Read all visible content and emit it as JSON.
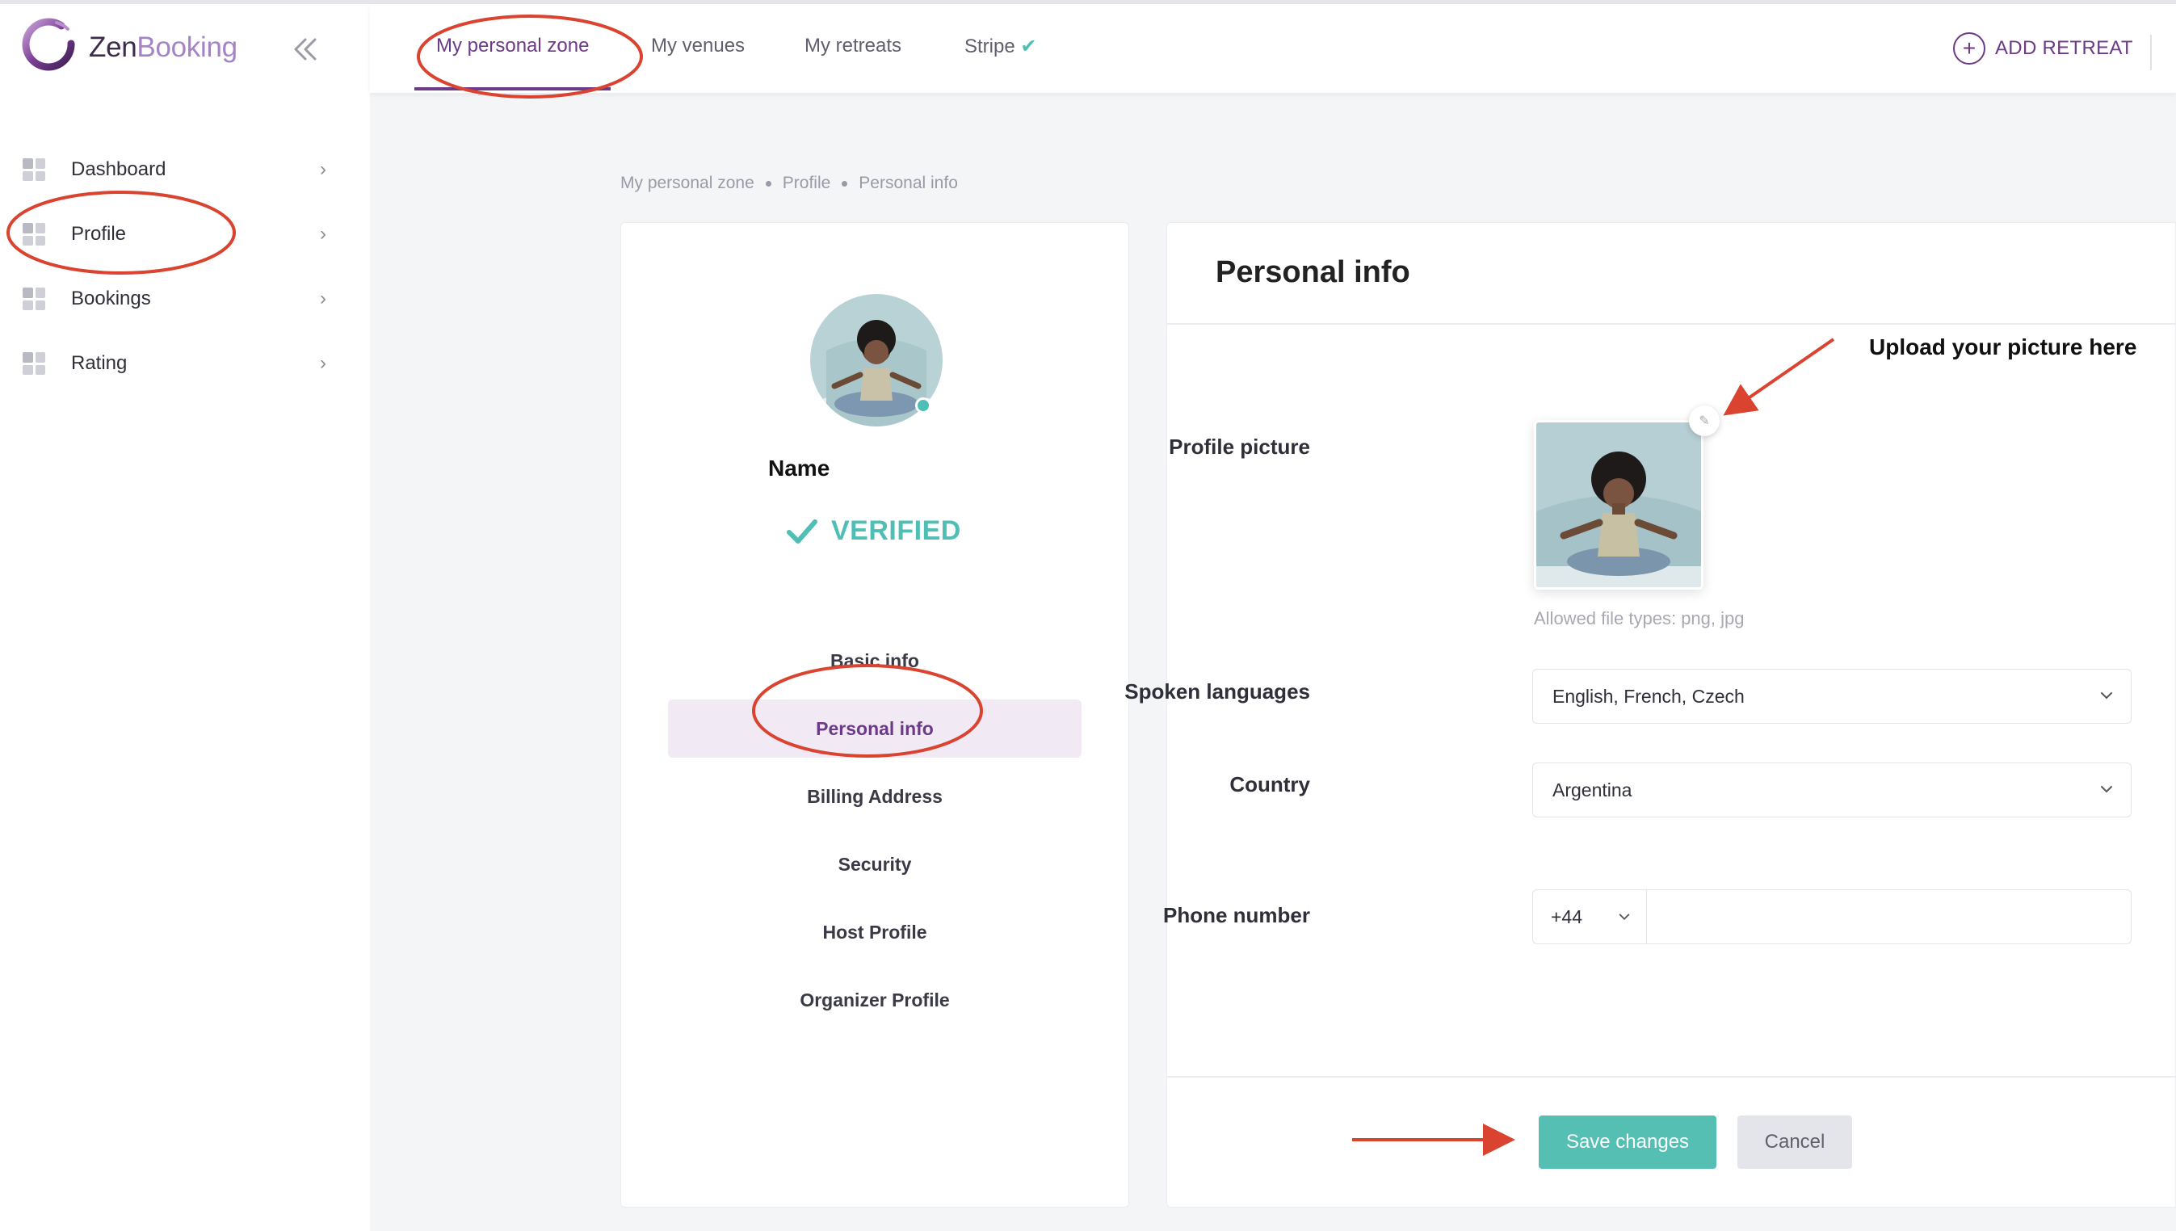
{
  "brand": {
    "name_part1": "Zen",
    "name_part2": "Booking"
  },
  "sidebar": {
    "items": [
      {
        "label": "Dashboard"
      },
      {
        "label": "Profile"
      },
      {
        "label": "Bookings"
      },
      {
        "label": "Rating"
      }
    ]
  },
  "header": {
    "tabs": [
      {
        "label": "My personal zone",
        "active": true
      },
      {
        "label": "My venues"
      },
      {
        "label": "My retreats"
      },
      {
        "label": "Stripe",
        "status_icon": "check-icon"
      }
    ],
    "add_retreat_label": "ADD RETREAT"
  },
  "breadcrumb": [
    "My personal zone",
    "Profile",
    "Personal info"
  ],
  "profile_card": {
    "name": "Name",
    "verified_label": "VERIFIED",
    "nav": [
      {
        "label": "Basic info"
      },
      {
        "label": "Personal info",
        "active": true
      },
      {
        "label": "Billing Address"
      },
      {
        "label": "Security"
      },
      {
        "label": "Host Profile"
      },
      {
        "label": "Organizer Profile"
      }
    ]
  },
  "form": {
    "title": "Personal info",
    "profile_picture_label": "Profile picture",
    "file_hint": "Allowed file types: png, jpg",
    "spoken_languages_label": "Spoken languages",
    "spoken_languages_value": "English, French, Czech",
    "country_label": "Country",
    "country_value": "Argentina",
    "phone_label": "Phone number",
    "phone_code": "+44",
    "phone_value": "",
    "save_label": "Save changes",
    "cancel_label": "Cancel"
  },
  "annotations": {
    "upload_hint": "Upload your picture here"
  },
  "colors": {
    "accent": "#6c3a86",
    "teal": "#55bfb4",
    "annotation": "#d9432f"
  }
}
